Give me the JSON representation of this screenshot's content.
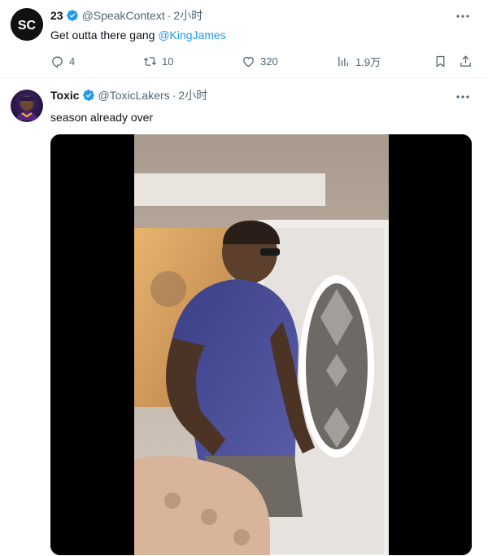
{
  "tweets": [
    {
      "display_name": "23",
      "handle": "@SpeakContext",
      "dot": "·",
      "time": "2小时",
      "text": "Get outta there gang ",
      "mention": "@KingJames",
      "avatar_text": "SC",
      "actions": {
        "replies": "4",
        "retweets": "10",
        "likes": "320",
        "views": "1.9万"
      }
    },
    {
      "display_name": "Toxic",
      "handle": "@ToxicLakers",
      "dot": "·",
      "time": "2小时",
      "text": "season already over"
    }
  ],
  "colors": {
    "accent": "#1d9bf0",
    "secondary_text": "#536471",
    "divider": "#eff3f4"
  },
  "icons": [
    "verified-badge-icon",
    "more-options-icon",
    "reply-icon",
    "retweet-icon",
    "like-icon",
    "views-icon",
    "bookmark-icon",
    "share-icon"
  ]
}
